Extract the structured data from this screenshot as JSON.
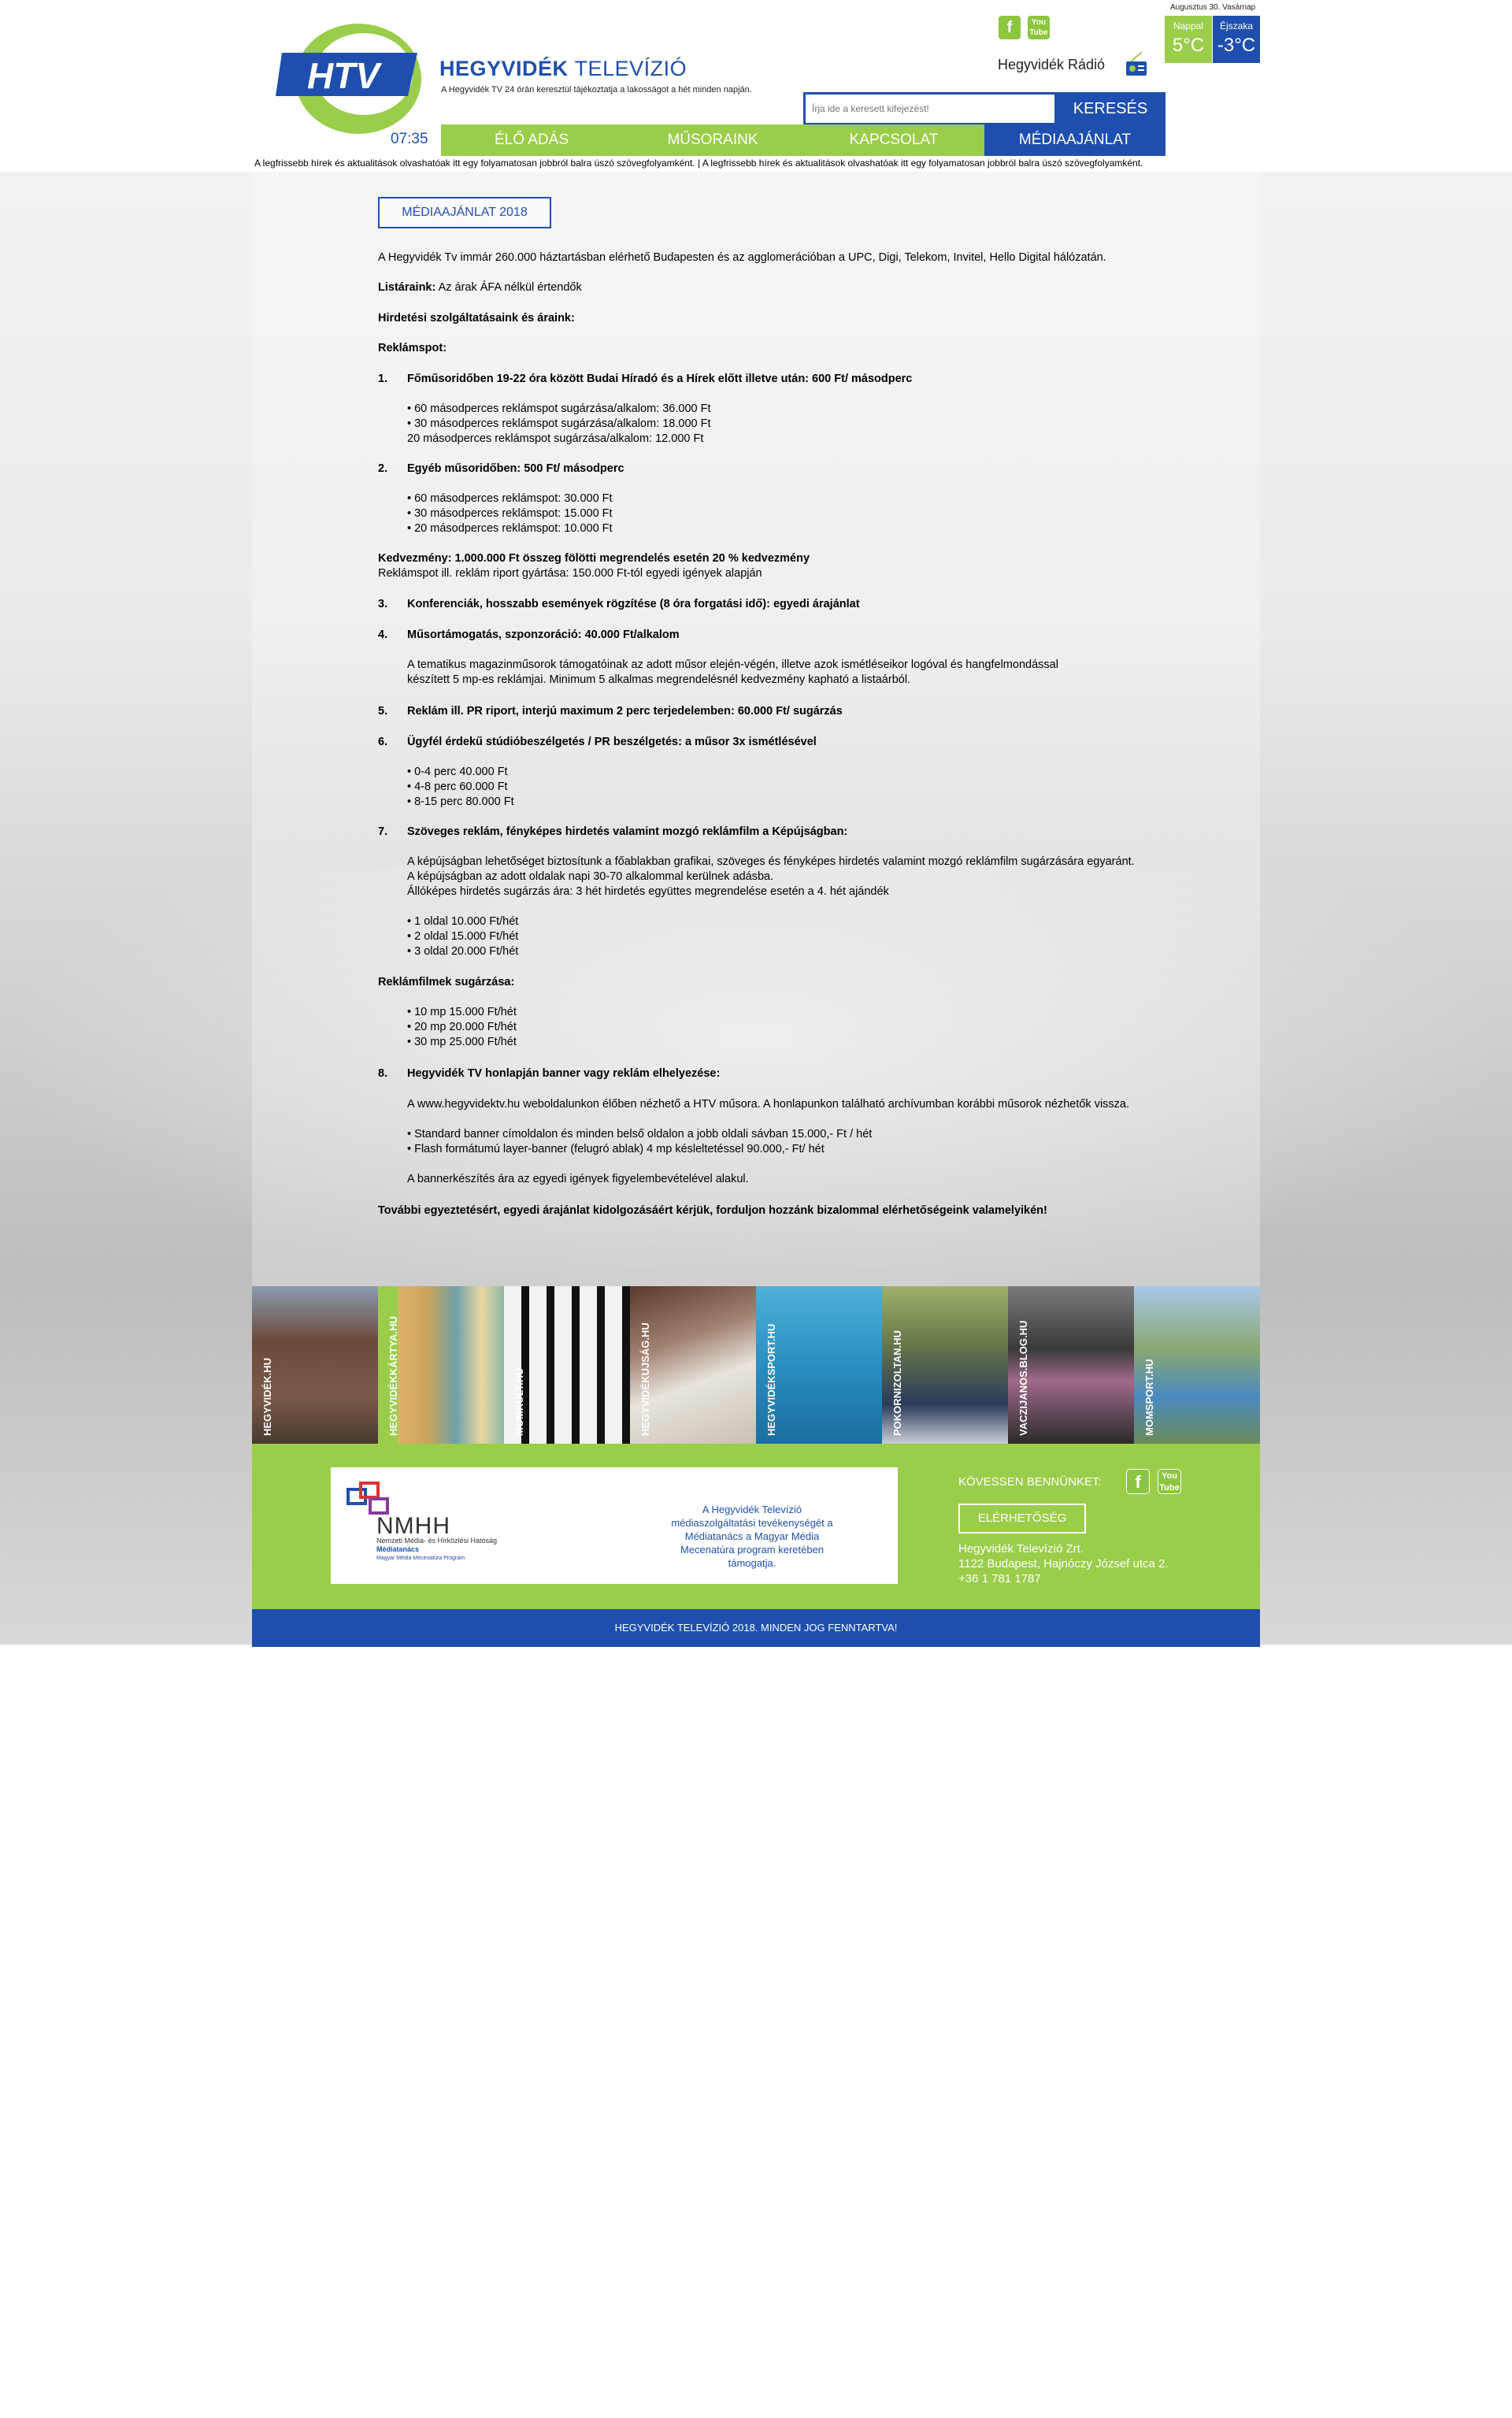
{
  "header": {
    "brand_title_bold": "HEGYVIDÉK",
    "brand_title_light": "TELEVÍZIÓ",
    "brand_subtitle": "A Hegyvidék TV 24 órán keresztül tájékoztatja a lakosságot a hét minden napján.",
    "date": "Augusztus 30. Vasárnap",
    "weather": {
      "day_label": "Nappal",
      "day_temp": "5°C",
      "night_label": "Éjszaka",
      "night_temp": "-3°C"
    },
    "radio_label": "Hegyvidék Rádió",
    "clock": "07:35",
    "search": {
      "placeholder": "Írja ide a keresett kifejezést!",
      "button": "KERESÉS"
    },
    "nav": [
      "ÉLŐ ADÁS",
      "MŰSORAINK",
      "KAPCSOLAT",
      "MÉDIAAJÁNLAT"
    ],
    "ticker": "A legfrissebb hírek és aktualitások olvashatóak itt egy folyamatosan jobbról balra úszó szövegfolyamként.   |   A legfrissebb hírek és aktualitások olvashatóak itt egy folyamatosan jobbról balra úszó szövegfolyamként."
  },
  "colors": {
    "brand_blue": "#1f4fae",
    "brand_green": "#9acd4a"
  },
  "main": {
    "badge": "MÉDIAAJÁNLAT 2018",
    "intro": "A Hegyvidék Tv immár 260.000 háztartásban elérhető Budapesten és az agglomerációban a UPC, Digi, Telekom, Invitel, Hello Digital hálózatán.",
    "price_list_label": "Listáraink:",
    "price_list_note": "Az árak ÁFA nélkül értendők",
    "services_heading": "Hirdetési szolgáltatásaink és áraink:",
    "spot_heading": "Reklámspot:",
    "items": [
      {
        "num": "1.",
        "title": "Főműsoridőben 19-22 óra között Budai Híradó és a Hírek előtt illetve után: 600 Ft/ másodperc",
        "lines": [
          "• 60 másodperces reklámspot sugárzása/alkalom: 36.000 Ft",
          "• 30 másodperces reklámspot sugárzása/alkalom: 18.000 Ft",
          "20 másodperces reklámspot sugárzása/alkalom: 12.000 Ft"
        ]
      },
      {
        "num": "2.",
        "title": "Egyéb műsoridőben: 500 Ft/ másodperc",
        "lines": [
          "• 60 másodperces reklámspot: 30.000 Ft",
          "• 30 másodperces reklámspot: 15.000 Ft",
          "• 20 másodperces reklámspot: 10.000 Ft"
        ]
      },
      {
        "num": "3.",
        "title": "Konferenciák, hosszabb események rögzítése (8 óra forgatási idő): egyedi árajánlat"
      },
      {
        "num": "4.",
        "title": "Műsortámogatás, szponzoráció: 40.000 Ft/alkalom",
        "lines": [
          "A tematikus magazinműsorok támogatóinak az adott műsor elején-végén, illetve azok ismétléseikor logóval és hangfelmondással",
          "készített 5 mp-es reklámjai. Minimum 5 alkalmas megrendelésnél kedvezmény kapható a listaárból."
        ]
      },
      {
        "num": "5.",
        "title": "Reklám ill. PR riport, interjú maximum 2 perc terjedelemben: 60.000 Ft/ sugárzás"
      },
      {
        "num": "6.",
        "title": "Ügyfél érdekű stúdióbeszélgetés / PR beszélgetés: a műsor 3x ismétlésével",
        "lines": [
          "• 0-4 perc 40.000 Ft",
          "• 4-8 perc 60.000 Ft",
          "• 8-15 perc 80.000 Ft"
        ]
      },
      {
        "num": "7.",
        "title": "Szöveges reklám, fényképes hirdetés valamint mozgó reklámfilm a Képújságban:",
        "lines": [
          "A képújságban lehetőséget biztosítunk a főablakban grafikai, szöveges és fényképes hirdetés valamint mozgó reklámfilm sugárzására egyaránt.",
          "A képújságban az adott oldalak napi 30-70 alkalommal kerülnek adásba.",
          "Állóképes hirdetés sugárzás ára: 3 hét hirdetés együttes megrendelése esetén a 4. hét ajándék"
        ],
        "lines2": [
          "• 1 oldal 10.000 Ft/hét",
          "• 2 oldal 15.000 Ft/hét",
          "• 3 oldal 20.000 Ft/hét"
        ]
      },
      {
        "num": "8.",
        "title": "Hegyvidék TV honlapján banner vagy reklám elhelyezése:",
        "lines": [
          "A www.hegyvidektv.hu weboldalunkon élőben nézhető a HTV műsora. A honlapunkon található archívumban korábbi műsorok nézhetők vissza."
        ],
        "lines2": [
          "• Standard banner címoldalon és minden belső oldalon a jobb oldali sávban 15.000,- Ft / hét",
          "• Flash formátumú layer-banner (felugró ablak) 4 mp késleltetéssel 90.000,- Ft/ hét"
        ],
        "lines3": [
          "A bannerkészítés ára az egyedi igények figyelembevételével alakul."
        ]
      }
    ],
    "discount_bold": "Kedvezmény: 1.000.000 Ft összeg fölötti megrendelés esetén 20 % kedvezmény",
    "discount_note": "Reklámspot ill. reklám riport gyártása: 150.000 Ft-tól egyedi igények alapján",
    "films_heading": "Reklámfilmek sugárzása:",
    "films_lines": [
      "• 10 mp 15.000 Ft/hét",
      "• 20 mp 20.000 Ft/hét",
      "• 30 mp 25.000 Ft/hét"
    ],
    "closing": "További egyeztetésért, egyedi árajánlat kidolgozásáért kérjük, forduljon hozzánk bizalommal elérhetőségeink valamelyikén!"
  },
  "tiles": [
    "HEGYVIDÉK.HU",
    "HEGYVIDÉKKÁRTYA.HU",
    "MOMKULT.HU",
    "HEGYVIDÉKUJSÁG.HU",
    "HEGYVIDÉKSPORT.HU",
    "POKORNIZOLTAN.HU",
    "VACZIJANOS.BLOG.HU",
    "MOMSPORT.HU"
  ],
  "footer": {
    "partner_text": "A Hegyvidék Televízió médiaszolgáltatási tevékenységét a Médiatanács a Magyar Média Mecenatúra program keretében támogatja.",
    "nmhh_logo_text": "NMHH",
    "nmhh_name": "Nemzeti Média- és Hírközlési Hatóság",
    "nmhh_council": "Médiatanács",
    "nmhh_program": "Magyar Média Mecenatúra Program",
    "follow_label": "KÖVESSEN BENNÜNKET:",
    "contact_button": "ELÉRHETŐSÉG",
    "address_lines": [
      "Hegyvidék Televízió Zrt.",
      "1122 Budapest, Hajnóczy József utca 2.",
      "+36 1 781 1787"
    ],
    "copyright": "HEGYVIDÉK TELEVÍZIÓ 2018. MINDEN JOG FENNTARTVA!"
  }
}
